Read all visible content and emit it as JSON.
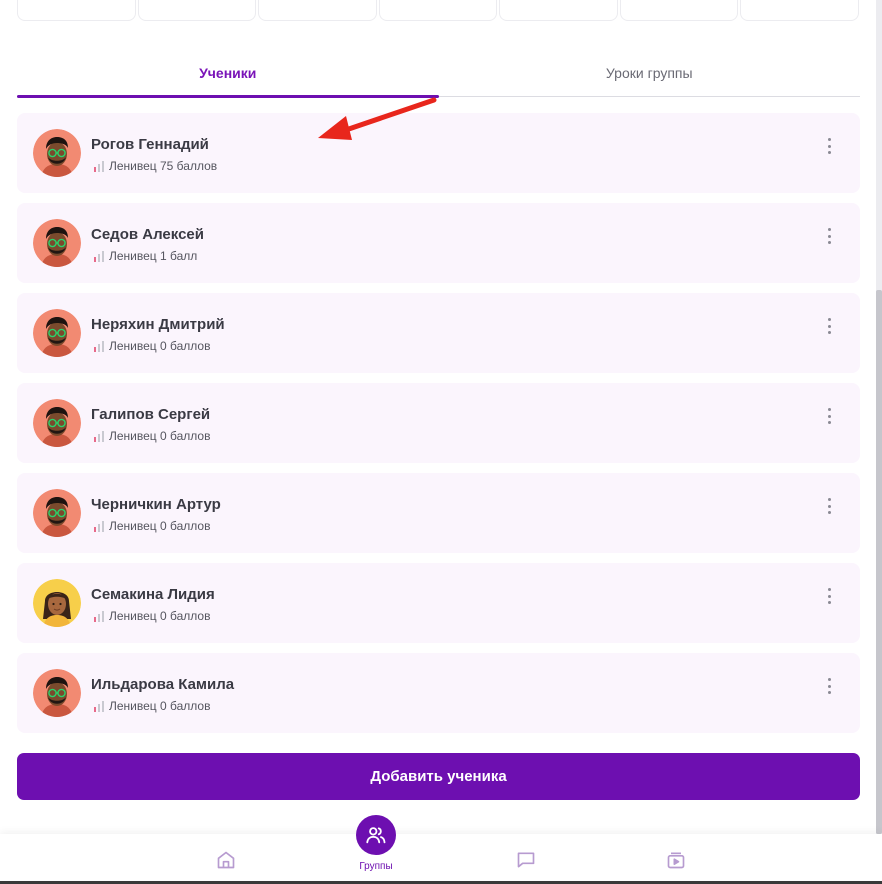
{
  "tabs": [
    {
      "label": "Ученики",
      "active": true
    },
    {
      "label": "Уроки группы",
      "active": false
    }
  ],
  "students": [
    {
      "name": "Рогов Геннадий",
      "level": "Ленивец 75 баллов",
      "avatar": "boy"
    },
    {
      "name": "Седов Алексей",
      "level": "Ленивец 1 балл",
      "avatar": "boy"
    },
    {
      "name": "Неряхин Дмитрий",
      "level": "Ленивец 0 баллов",
      "avatar": "boy"
    },
    {
      "name": "Галипов Сергей",
      "level": "Ленивец 0 баллов",
      "avatar": "boy"
    },
    {
      "name": "Черничкин Артур",
      "level": "Ленивец 0 баллов",
      "avatar": "boy"
    },
    {
      "name": "Семакина Лидия",
      "level": "Ленивец 0 баллов",
      "avatar": "girl"
    },
    {
      "name": "Ильдарова Камила",
      "level": "Ленивец 0 баллов",
      "avatar": "boy"
    }
  ],
  "actions": {
    "add_student": "Добавить ученика"
  },
  "bottom_nav": {
    "items": [
      {
        "icon": "home-icon"
      },
      {
        "icon": "groups-icon",
        "label": "Группы",
        "active": true
      },
      {
        "icon": "chat-icon"
      },
      {
        "icon": "media-icon"
      }
    ]
  },
  "colors": {
    "accent": "#6d0fb0",
    "card_bg": "#fbf5fd",
    "level_bar": "#e86a8a"
  }
}
